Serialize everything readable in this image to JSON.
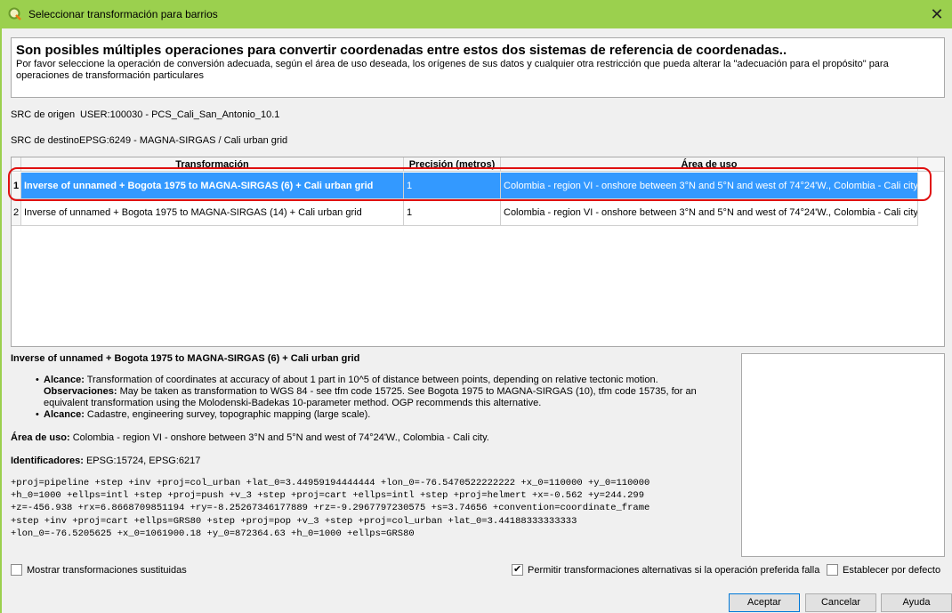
{
  "window": {
    "title": "Seleccionar transformación para barrios",
    "close_icon": "close-icon"
  },
  "info": {
    "heading": "Son posibles múltiples operaciones para convertir coordenadas entre estos dos sistemas de referencia de coordenadas..",
    "text": "Por favor seleccione la operación de conversión adecuada, según el área de uso deseada, los orígenes de sus datos y cualquier otra restricción que pueda alterar la \"adecuación para el propósito\" para operaciones de transformación particulares"
  },
  "source_crs": {
    "label": "SRC de origen",
    "value": "USER:100030 - PCS_Cali_San_Antonio_10.1"
  },
  "dest_crs": {
    "label": "SRC de destino",
    "value": "EPSG:6249 - MAGNA-SIRGAS / Cali urban grid"
  },
  "table": {
    "headers": [
      "Transformación",
      "Precisión (metros)",
      "Área de uso"
    ],
    "rows": [
      {
        "num": "1",
        "transformation": "Inverse of unnamed + Bogota 1975 to MAGNA-SIRGAS (6) + Cali urban grid",
        "precision": "1",
        "area": "Colombia - region VI - onshore between 3°N and 5°N and west of 74°24'W., Colombia - Cali city.",
        "selected": true
      },
      {
        "num": "2",
        "transformation": "Inverse of unnamed + Bogota 1975 to MAGNA-SIRGAS (14) + Cali urban grid",
        "precision": "1",
        "area": "Colombia - region VI - onshore between 3°N and 5°N and west of 74°24'W., Colombia - Cali city.",
        "selected": false
      }
    ]
  },
  "details": {
    "title": "Inverse of unnamed + Bogota 1975 to MAGNA-SIRGAS (6) + Cali urban grid",
    "items": [
      {
        "label": "Alcance:",
        "text": "Transformation of coordinates at accuracy of about 1 part in 10^5 of distance between points, depending on relative tectonic motion."
      },
      {
        "label": "Observaciones:",
        "text": "May be taken as transformation to WGS 84 - see tfm code 15725. See Bogota 1975 to MAGNA-SIRGAS (10), tfm code 15735, for an equivalent transformation using the Molodenski-Badekas 10-parameter method. OGP recommends this alternative."
      },
      {
        "label": "Alcance:",
        "text": "Cadastre, engineering survey, topographic mapping (large scale)."
      }
    ],
    "area_label": "Área de uso:",
    "area_value": "Colombia - region VI - onshore between 3°N and 5°N and west of 74°24'W., Colombia - Cali city.",
    "ids_label": "Identificadores:",
    "ids_value": "EPSG:15724, EPSG:6217",
    "proj_lines": [
      "+proj=pipeline +step +inv +proj=col_urban +lat_0=3.44959194444444 +lon_0=-76.5470522222222 +x_0=110000 +y_0=110000",
      "+h_0=1000 +ellps=intl +step +proj=push +v_3 +step +proj=cart +ellps=intl +step +proj=helmert +x=-0.562 +y=244.299",
      "+z=-456.938 +rx=6.8668709851194 +ry=-8.25267346177889 +rz=-9.2967797230575 +s=3.74656 +convention=coordinate_frame",
      "+step +inv +proj=cart +ellps=GRS80 +step +proj=pop +v_3 +step +proj=col_urban +lat_0=3.44188333333333",
      "+lon_0=-76.5205625 +x_0=1061900.18 +y_0=872364.63 +h_0=1000 +ellps=GRS80"
    ]
  },
  "options": {
    "show_superseded": {
      "label": "Mostrar transformaciones sustituidas",
      "checked": false
    },
    "allow_fallback": {
      "label": "Permitir transformaciones alternativas si la operación preferida falla",
      "checked": true
    },
    "set_default": {
      "label": "Establecer por defecto",
      "checked": false
    }
  },
  "buttons": {
    "accept": "Aceptar",
    "cancel": "Cancelar",
    "help": "Ayuda"
  },
  "colors": {
    "titlebar": "#9bd04e",
    "selection": "#3399ff",
    "highlight": "#e01010"
  }
}
